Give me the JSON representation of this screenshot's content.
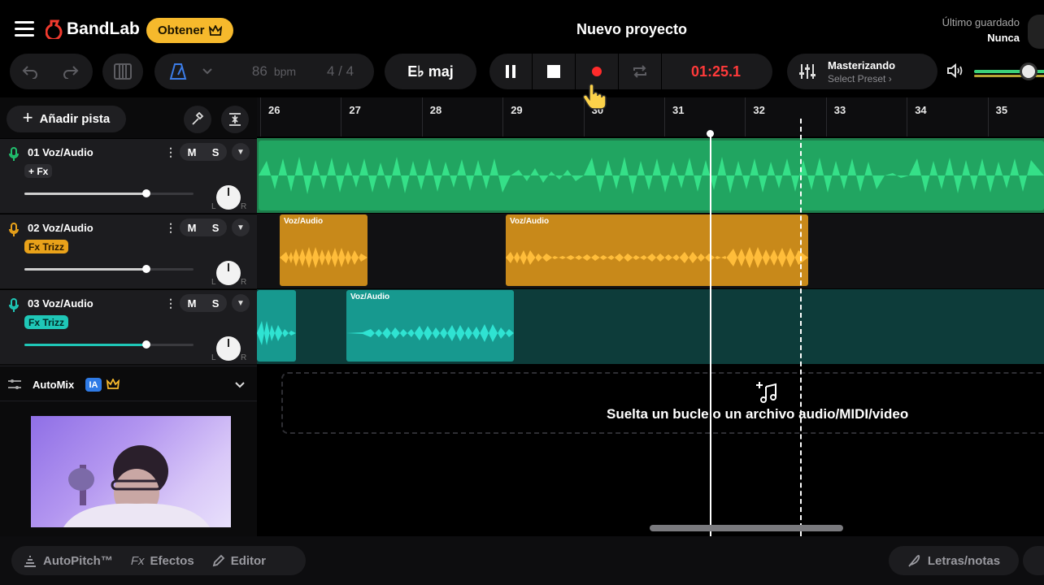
{
  "header": {
    "logo": "BandLab",
    "obtener_label": "Obtener",
    "project_title": "Nuevo proyecto",
    "saved_label": "Último guardado",
    "saved_value": "Nunca"
  },
  "toolbar": {
    "bpm_value": "86",
    "bpm_unit": "bpm",
    "time_signature": "4 / 4",
    "key": "E♭ maj",
    "time": "01:25.1",
    "master_title": "Masterizando",
    "master_preset": "Select Preset"
  },
  "tracks_panel": {
    "add_track_label": "Añadir pista",
    "mute_label": "M",
    "solo_label": "S",
    "pan_left": "L",
    "pan_right": "R"
  },
  "tracks": [
    {
      "name": "01  Voz/Audio",
      "fx": "+ Fx",
      "color": "#21c06e",
      "volume": 0.72
    },
    {
      "name": "02  Voz/Audio",
      "fx": "Fx Trizz",
      "color": "#e9a21a",
      "volume": 0.72
    },
    {
      "name": "03  Voz/Audio",
      "fx": "Fx Trizz",
      "color": "#1fc7b7",
      "volume": 0.72
    }
  ],
  "automix": {
    "label": "AutoMix",
    "badge": "IA"
  },
  "ruler": {
    "bars": [
      "26",
      "27",
      "28",
      "29",
      "30",
      "31",
      "32",
      "33",
      "34",
      "35"
    ]
  },
  "clips": {
    "clip_label": "Voz/Audio"
  },
  "drop_zone": {
    "text": "Suelta un bucle o un archivo audio/MIDI/video"
  },
  "bottom_bar": {
    "autopitch": "AutoPitch™",
    "effects": "Efectos",
    "effects_prefix": "Fx",
    "editor": "Editor",
    "lyrics": "Letras/notas"
  },
  "colors": {
    "accent_yellow": "#f6b92c",
    "record_red": "#ff3a3a",
    "track1_green": "#21c06e",
    "track2_orange": "#e9a21a",
    "track3_teal": "#1fc7b7"
  }
}
